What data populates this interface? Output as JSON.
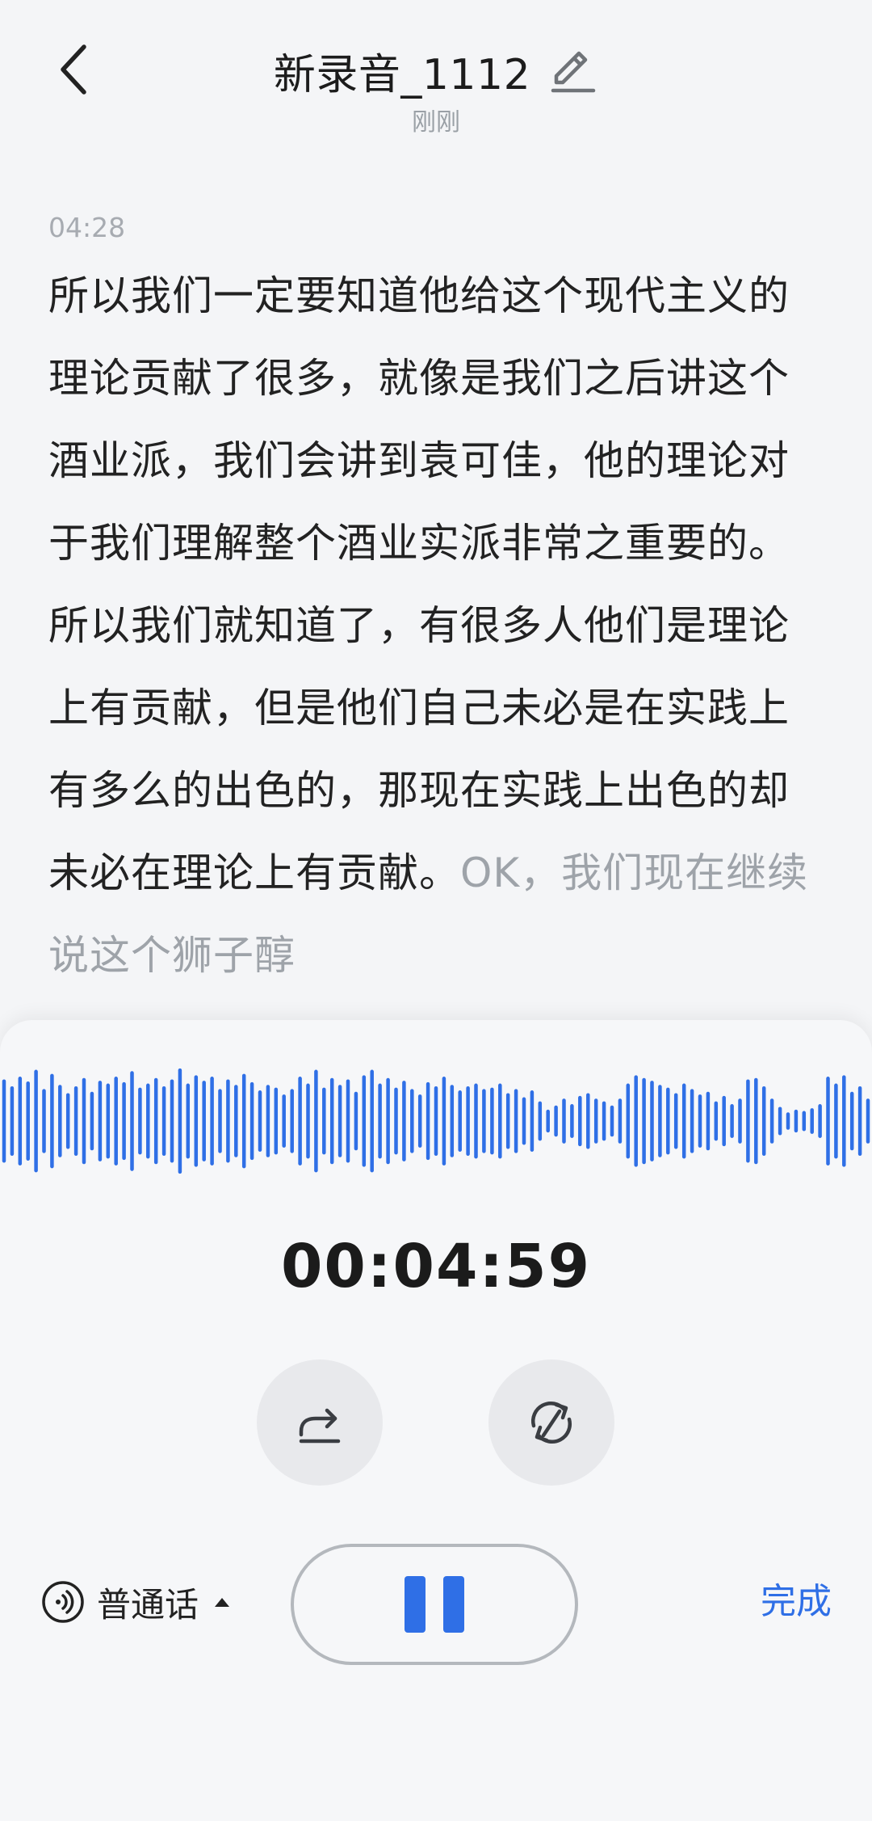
{
  "header": {
    "title": "新录音_1112",
    "subtitle": "刚刚"
  },
  "transcript": {
    "timestamp": "04:28",
    "final_text": "所以我们一定要知道他给这个现代主义的理论贡献了很多，就像是我们之后讲这个酒业派，我们会讲到袁可佳，他的理论对于我们理解整个酒业实派非常之重要的。所以我们就知道了，有很多人他们是理论上有贡献，但是他们自己未必是在实践上有多么的出色的，那现在实践上出色的却未必在理论上有贡献。",
    "pending_text": "OK，我们现在继续说这个狮子醇"
  },
  "recorder": {
    "timer": "00:04:59",
    "language_label": "普通话",
    "done_label": "完成",
    "accent_color": "#2f6fe6",
    "waveform_levels": [
      0.58,
      0.48,
      0.62,
      0.55,
      0.72,
      0.44,
      0.66,
      0.5,
      0.38,
      0.48,
      0.6,
      0.4,
      0.56,
      0.52,
      0.62,
      0.54,
      0.7,
      0.46,
      0.52,
      0.6,
      0.48,
      0.58,
      0.74,
      0.52,
      0.64,
      0.56,
      0.62,
      0.44,
      0.58,
      0.5,
      0.66,
      0.54,
      0.42,
      0.5,
      0.46,
      0.36,
      0.44,
      0.62,
      0.52,
      0.72,
      0.46,
      0.6,
      0.5,
      0.58,
      0.4,
      0.64,
      0.72,
      0.52,
      0.6,
      0.46,
      0.56,
      0.44,
      0.36,
      0.54,
      0.48,
      0.62,
      0.5,
      0.42,
      0.48,
      0.52,
      0.44,
      0.46,
      0.52,
      0.38,
      0.44,
      0.32,
      0.42,
      0.26,
      0.14,
      0.2,
      0.3,
      0.22,
      0.34,
      0.38,
      0.3,
      0.26,
      0.2,
      0.3,
      0.52,
      0.64,
      0.6,
      0.56,
      0.5,
      0.46,
      0.38,
      0.52,
      0.44,
      0.36,
      0.4,
      0.26,
      0.34,
      0.22,
      0.3,
      0.58,
      0.6,
      0.48,
      0.3,
      0.18,
      0.1,
      0.14,
      0.12,
      0.16,
      0.22,
      0.62,
      0.52,
      0.64,
      0.4,
      0.48,
      0.3
    ]
  }
}
